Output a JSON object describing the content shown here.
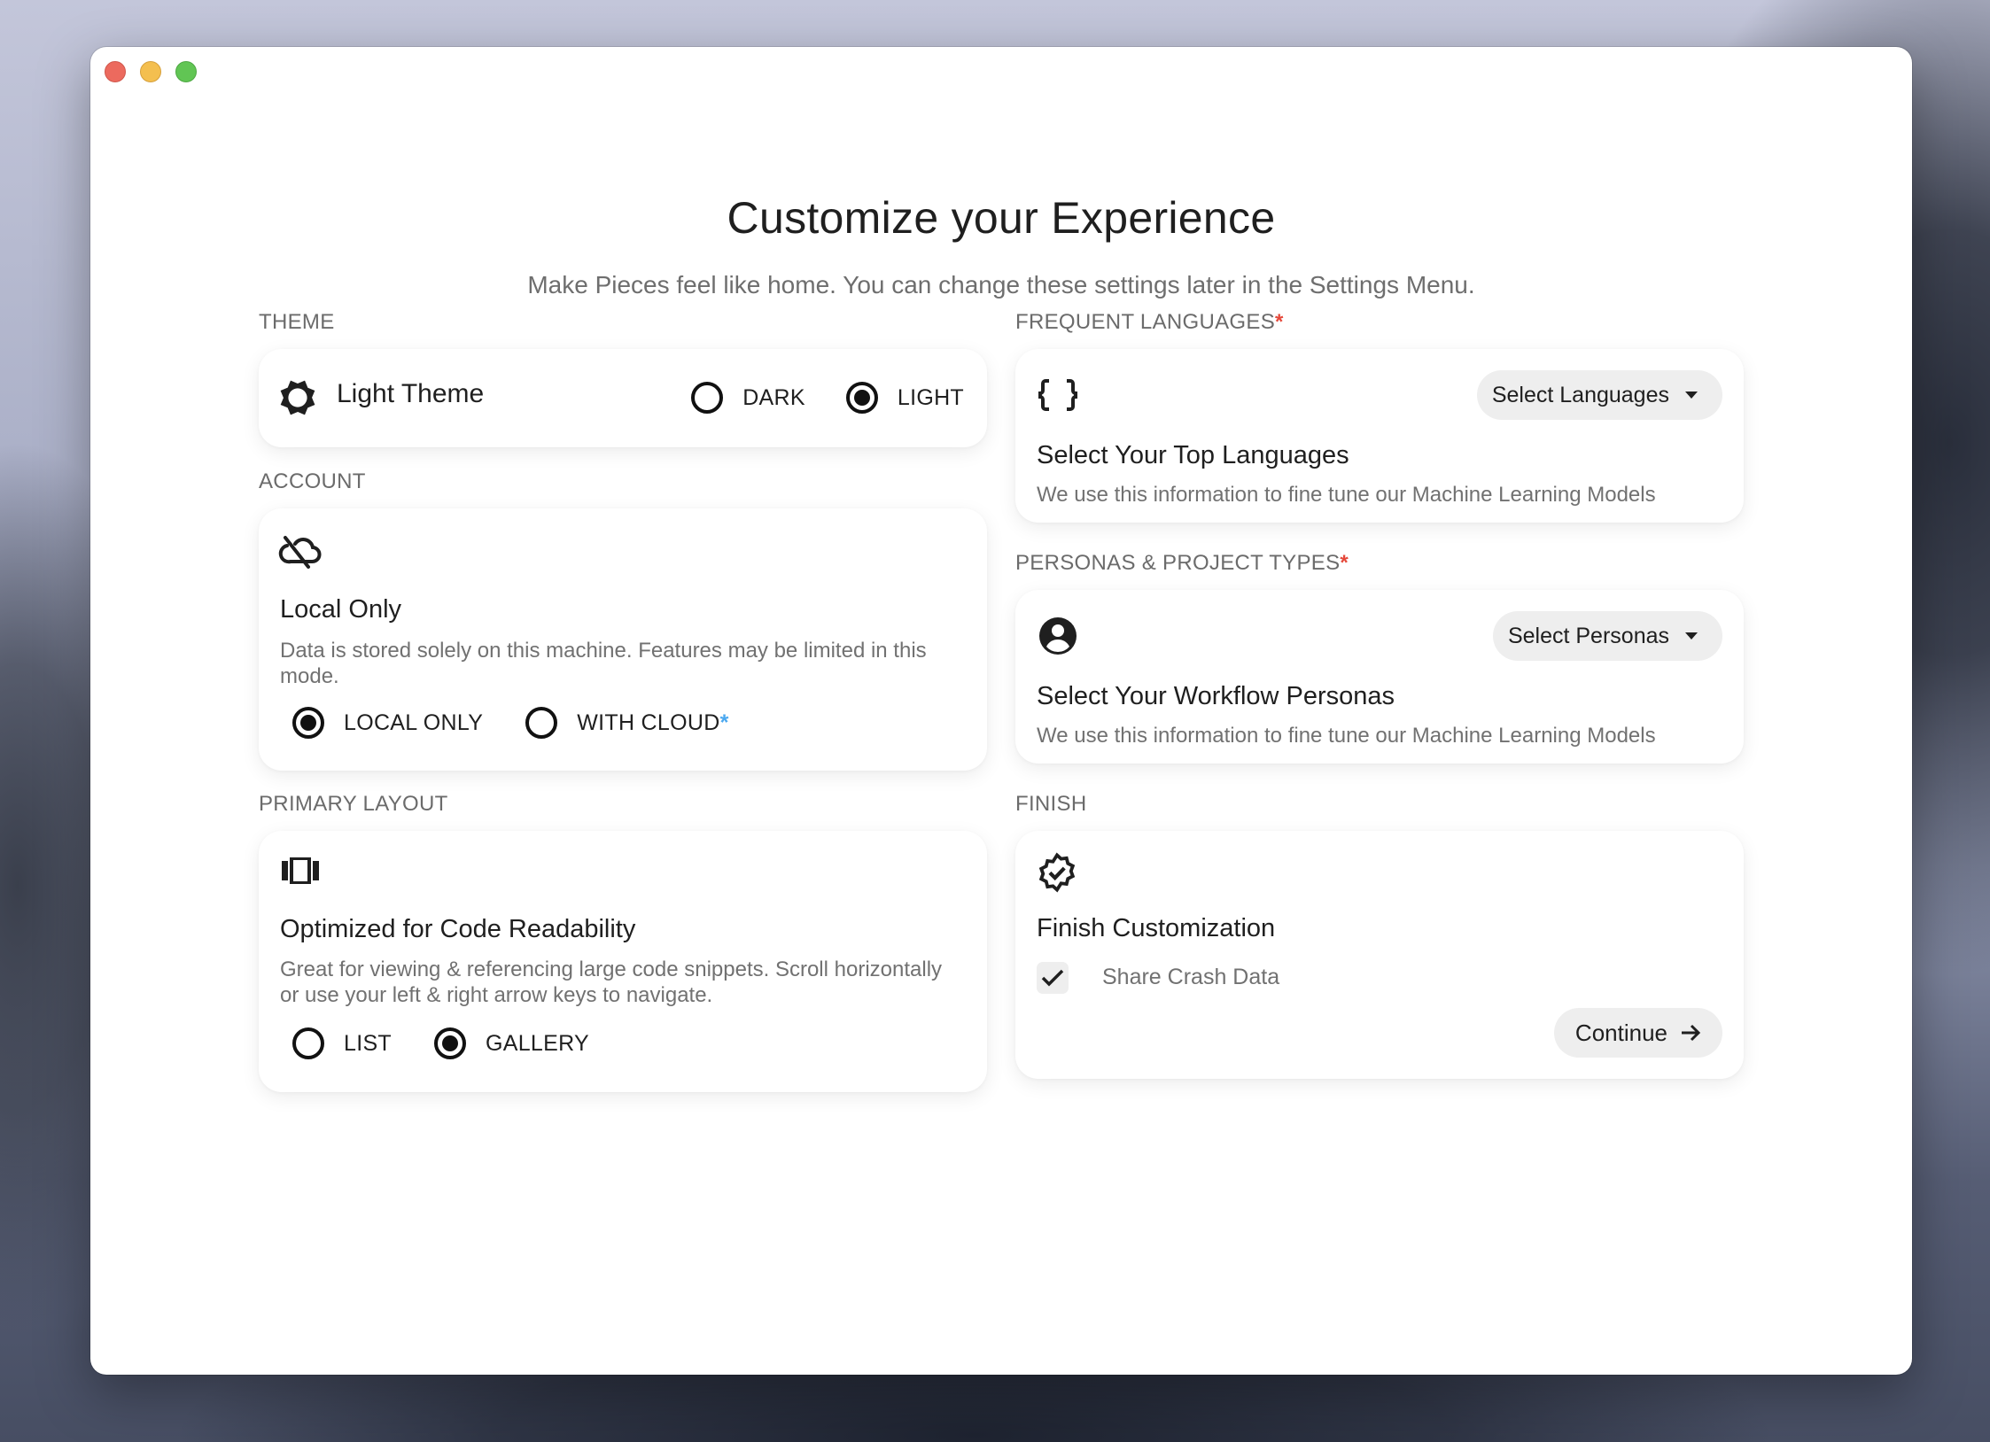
{
  "window": {
    "controls": [
      "close",
      "minimize",
      "maximize"
    ]
  },
  "header": {
    "title": "Customize your Experience",
    "subtitle": "Make Pieces feel like home. You can change these settings later in the Settings Menu."
  },
  "theme": {
    "section_label": "THEME",
    "icon": "brightness-icon",
    "current_label": "Light Theme",
    "options": [
      {
        "label": "DARK",
        "selected": false
      },
      {
        "label": "LIGHT",
        "selected": true
      }
    ]
  },
  "account": {
    "section_label": "ACCOUNT",
    "icon": "cloud-off-icon",
    "heading": "Local Only",
    "description": "Data is stored solely on this machine. Features may be limited in this mode.",
    "options": [
      {
        "label": "LOCAL ONLY",
        "selected": true
      },
      {
        "label": "WITH CLOUD",
        "selected": false,
        "marker": "*"
      }
    ]
  },
  "layout": {
    "section_label": "PRIMARY LAYOUT",
    "icon": "view-carousel-icon",
    "heading": "Optimized for Code Readability",
    "description": "Great for viewing & referencing large code snippets. Scroll horizontally or use your left & right arrow keys to navigate.",
    "options": [
      {
        "label": "LIST",
        "selected": false
      },
      {
        "label": "GALLERY",
        "selected": true
      }
    ]
  },
  "languages": {
    "section_label": "FREQUENT LANGUAGES",
    "required_marker": "*",
    "icon": "code-braces-icon",
    "dropdown_label": "Select Languages",
    "heading": "Select Your Top Languages",
    "description": "We use this information to fine tune our Machine Learning Models"
  },
  "personas": {
    "section_label": "PERSONAS & PROJECT TYPES",
    "required_marker": "*",
    "icon": "account-circle-icon",
    "dropdown_label": "Select Personas",
    "heading": "Select Your Workflow Personas",
    "description": "We use this information to fine tune our Machine Learning Models"
  },
  "finish": {
    "section_label": "FINISH",
    "icon": "verified-badge-icon",
    "heading": "Finish Customization",
    "checkbox_label": "Share Crash Data",
    "checkbox_checked": true,
    "continue_label": "Continue"
  },
  "colors": {
    "required_marker": "#e5483a",
    "cloud_marker": "#4aa8f0",
    "pill_background": "#eeeeee",
    "text_primary": "#1f1f1f",
    "text_secondary": "#717171"
  }
}
